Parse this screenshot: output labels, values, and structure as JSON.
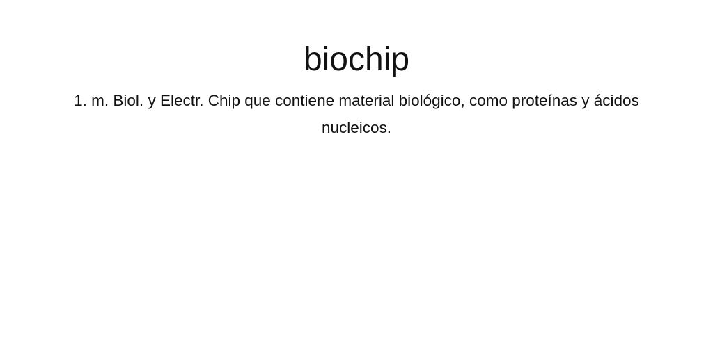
{
  "entry": {
    "headword": "biochip",
    "definition": "1. m. Biol. y Electr. Chip que contiene material biológico, como proteínas y ácidos nucleicos."
  }
}
